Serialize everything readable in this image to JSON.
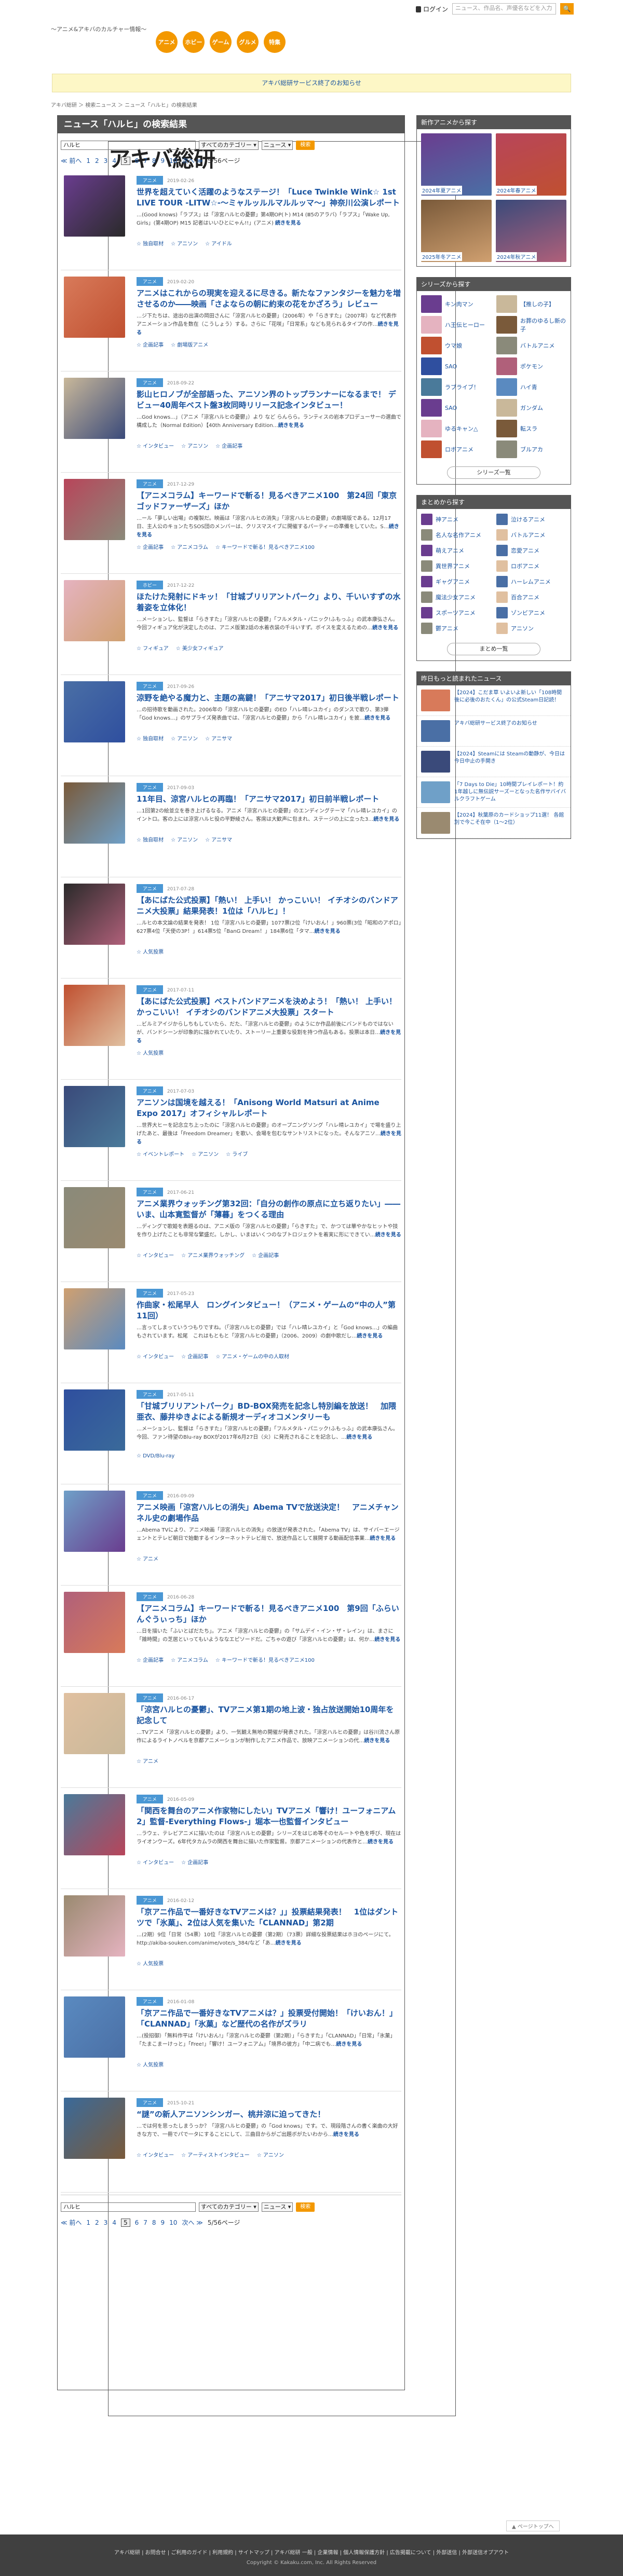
{
  "topbar": {
    "login": "ログイン",
    "search_placeholder": "ニュース、作品名、声優名などを入力",
    "search_btn": "🔍"
  },
  "logo": {
    "main": "アキバ総研",
    "sub": "〜アニメ&アキバのカルチャー情報〜"
  },
  "cats": [
    "アニメ",
    "ホビー",
    "ゲーム",
    "グルメ",
    "特集"
  ],
  "notice": "アキバ総研サービス終了のお知らせ",
  "breadcrumb": "アキバ総研 ＞ 検索ニュース ＞ ニュース「ハルヒ」の検索結果",
  "main": {
    "title": "ニュース「ハルヒ」の検索結果",
    "query": "ハルヒ",
    "genre": "すべてのカテゴリー ▾",
    "type": "ニュース ▾",
    "go": "検索",
    "pager": {
      "prev": "≪ 前へ",
      "pages": [
        "1",
        "2",
        "3",
        "4",
        "5",
        "6",
        "7",
        "8",
        "9",
        "10"
      ],
      "current": "5",
      "next": "次へ ≫",
      "count": "5/56ページ"
    },
    "items": [
      {
        "tag": "アニメ",
        "date": "2019-02-26",
        "title": "世界を超えていく活躍のようなステージ！「Luce Twinkle Wink☆ 1st LIVE TOUR -LITW☆-～ミャルッルルマルルッマ～」神奈川公演レポート",
        "desc": "…(Good knows)「ラプス」は「涼宮ハルヒの憂鬱」第4期OP(ト) M14 (Ⅲ5のアラバ)「ラプス」「Wake Up, Girls」(第4期OP) M15 記者はいいひとにゃん!!」(アニメ) ",
        "tags": [
          "☆ 独自取材",
          "☆ アニソン",
          "☆ アイドル"
        ]
      },
      {
        "tag": "アニメ",
        "date": "2019-02-20",
        "title": "アニメはこれからの現実を迎えるに尽きる。新たなファンタジーを魅力を増させるのか――映画「さよならの朝に約束の花をかざろう」レビュー",
        "desc": "…ジ下たちは、途出の出演の岡田さんに「涼宮ハルヒの憂鬱」（2006年）や「らきすた」（2007年）など代表作アニメーション作品を数在（こうしょう）する。さらに「花咲」「日常系」なども見られるタイプの作…",
        "tags": [
          "☆ 企画記事",
          "☆ 劇場版アニメ"
        ]
      },
      {
        "tag": "アニメ",
        "date": "2018-09-22",
        "title": "影山ヒロノブが全部語った、アニソン界のトップランナーになるまで！ デビュー40周年ベスト盤3枚同時リリース記念インタビュー！",
        "desc": "…God knows...」（アニメ「涼宮ハルヒの憂鬱」）より など らんらら。ランティスの岩本プロデューサーの選曲で構成した（Normal Edition）【40th Anniversary Edition…",
        "tags": [
          "☆ インタビュー",
          "☆ アニソン",
          "☆ 企画記事"
        ]
      },
      {
        "tag": "アニメ",
        "date": "2017-12-29",
        "title": "【アニメコラム】キーワードで斬る！見るべきアニメ100　第24回「東京ゴッドファーザーズ」ほか",
        "desc": "…ール「夢しい出場」の複製だ。映画は「涼宮ハルヒの消失」「涼宮ハルヒの憂鬱」の劇場版である。12月17日、主人公のキョンたちSOS団のメンバーは、クリスマスイブに開催するパーティーの準備をしていた。S…",
        "tags": [
          "☆ 企画記事",
          "☆ アニメコラム",
          "☆ キーワードで斬る！見るべきアニメ100"
        ]
      },
      {
        "tag": "ホビー",
        "date": "2017-12-22",
        "title": "ほたけた発射にドキッ！「甘城ブリリアントパーク」より、千いいすずの水着姿を立体化！",
        "desc": "…メーションし、監督は「らきすた」「涼宮ハルヒの憂鬱」「フルメタル・パニック!ふもっふ」の武本康弘さん。今回フィギュア化が決定したのは、アニメ版第2話の水着衣装の千斗いすず。ボイスを変えるための…",
        "tags": [
          "☆ フィギュア",
          "☆ 美少女フィギュア"
        ]
      },
      {
        "tag": "アニメ",
        "date": "2017-09-26",
        "title": "涼野を絶やる魔力と、主題の高鍵！「アニサマ2017」初日後半戦レポート",
        "desc": "…の招待歌を動画された。2006年の「涼宮ハルヒの憂鬱」のED「ハレ晴レユカイ」のダンスで歌り、第3弾「God knows...」のサプライズ発表曲では、「涼宮ハルヒの憂鬱」から「ハレ晴レユカイ」を披…",
        "tags": [
          "☆ 独自取材",
          "☆ アニソン",
          "☆ アニサマ"
        ]
      },
      {
        "tag": "アニメ",
        "date": "2017-09-03",
        "title": "11年目、涼宮ハルヒの再臨！「アニサマ2017」初日前半戦レポート",
        "desc": "…1回第2の絵並立を巻き上げるなる。アニメ「涼宮ハルヒの憂鬱」のエンディングテーマ「ハレ晴レユカイ」のイントロ。客の上には涼宮ハルヒ役の平野綾さん。客席は大歓声に包まれ、ステージの上に立った3…",
        "tags": [
          "☆ 独自取材",
          "☆ アニソン",
          "☆ アニサマ"
        ]
      },
      {
        "tag": "アニメ",
        "date": "2017-07-28",
        "title": "【あにばた公式投票】「熱い！ 上手い！ かっこいい！ イチオシのバンドアニメ大投票」結果発表！1位は「ハルヒ」！",
        "desc": "…ルヒの本文論の結果を発表！ 1位「涼宮ハルヒの憂鬱」1077票(2位「けいおん！」960票(3位「昭和のアポロ」627票4位「天使の3P！」614票5位「BanG Dream！」184票6位「タマ…",
        "tags": [
          "☆ 人気投票"
        ]
      },
      {
        "tag": "アニメ",
        "date": "2017-07-11",
        "title": "【あにばた公式投票】ベストバンドアニメを決めよう！「熱い！ 上手い！ かっこいい！ イチオシのバンドアニメ大投票」スタート",
        "desc": "…ビルミアイジからしちもしていたら、だた、「涼宮ハルヒの憂鬱」のようにか作品前後にバンドものではないが、バンドシーンが印象的に描かれていたり、ストーリー上重要な役割を持つ作品もある。投票は本日…",
        "tags": [
          "☆ 人気投票"
        ]
      },
      {
        "tag": "アニメ",
        "date": "2017-07-03",
        "title": "アニソンは国境を越える！「Anisong World Matsuri at Anime Expo 2017」オフィシャルレポート",
        "desc": "…世界大ヒーを記念立ち上ったのに「涼宮ハルヒの憂鬱」のオープニングソング「ハレ晴レユカイ」で場を盛り上げたあと、最後は「Freedom Dreamer」を歌い、会場を包むなサントリストになった。そんなアニソ…",
        "tags": [
          "☆ イベントレポート",
          "☆ アニソン",
          "☆ ライブ"
        ]
      },
      {
        "tag": "アニメ",
        "date": "2017-06-21",
        "title": "アニメ業界ウォッチング第32回：「自分の創作の原点に立ち返りたい」――いま、山本寛監督が「薄暮」をつくる理由",
        "desc": "…ディングで歌姫を表題るのは、アニメ版の「涼宮ハルヒの憂鬱」「らきすた」で、かつては華やかなヒットや技を作り上げたことも非常な繁盛だ。しかし、いまはいくつのなブトロジェクトを着実に形にできてい…",
        "tags": [
          "☆ インタビュー",
          "☆ アニメ業界ウォッチング",
          "☆ 企画記事"
        ]
      },
      {
        "tag": "アニメ",
        "date": "2017-05-23",
        "title": "作曲家・松尾早人　ロングインタビュー！（アニメ・ゲームの“中の人”第11回）",
        "desc": "…言ってしまっていうつもりですね。（「涼宮ハルヒの憂鬱」では「ハレ晴レユカイ」と「God knows...」の編曲もされています。松尾　これはもともと「涼宮ハルヒの憂鬱」（2006、2009）の劇中歌だし…",
        "tags": [
          "☆ インタビュー",
          "☆ 企画記事",
          "☆ アニメ・ゲームの中の人取材"
        ]
      },
      {
        "tag": "アニメ",
        "date": "2017-05-11",
        "title": "「甘城ブリリアントパーク」BD-BOX発売を記念し特別編を放送！　加隈亜衣、藤井ゆきよによる新規オーディオコメンタリーも",
        "desc": "…メーションし、監督は「らきすた」「涼宮ハルヒの憂鬱」「フルメタル・パニック!ふもっふ」の武本康弘さん。今回、ファン待望のBlu-ray BOXが2017年6月27日（火）に発売されることを記念し、…",
        "tags": [
          "☆ DVD/Blu-ray"
        ]
      },
      {
        "tag": "アニメ",
        "date": "2016-09-09",
        "title": "アニメ映画「涼宮ハルヒの消失」Abema TVで放送決定！　アニメチャンネル史の劇場作品",
        "desc": "…Abema TVにより、アニメ映画「涼宮ハルヒの消失」の放送が発表された。「Abema TV」は、サイバーエージェントとテレビ朝日で始動するインターネットテレビ局で、放送作品として展開する動画配信事業…",
        "tags": [
          "☆ アニメ"
        ]
      },
      {
        "tag": "アニメ",
        "date": "2016-06-28",
        "title": "【アニメコラム】キーワードで斬る！見るべきアニメ100　第9回「ふらいんぐうぃっち」ほか",
        "desc": "…日を描いた「ふいとばだたち」。アニメ「涼宮ハルヒの憂鬱」の「サムデイ・イン・ザ・レイン」は、まさに「雑時間」の芝居といってもいようななエピソードだ。ごちゃの遊び「涼宮ハルヒの憂鬱」は、何か…",
        "tags": [
          "☆ 企画記事",
          "☆ アニメコラム",
          "☆ キーワードで斬る！見るべきアニメ100"
        ]
      },
      {
        "tag": "アニメ",
        "date": "2016-06-17",
        "title": "「涼宮ハルヒの憂鬱」、TVアニメ第1期の地上波・独占放送開始10周年を記念して",
        "desc": "…TVアニメ「涼宮ハルヒの憂鬱」より、一気観え無地の開催が発表された。「涼宮ハルヒの憂鬱」は谷川流さん原作によるライトノベルを京都アニメーションが制作したアニメ作品で、放映アニメーションの代…",
        "tags": [
          "☆ アニメ"
        ]
      },
      {
        "tag": "アニメ",
        "date": "2016-05-09",
        "title": "「関西を舞台のアニメ作家物にしたい」TVアニメ「響け！ユーフォニアム2」監督-Everything Flows-」堀本一也監督インタビュー",
        "desc": "…ラウェ、テレビアニメに描いたのは「涼宮ハルヒの憂鬱」シリーズをはじめ等そのセルートや色を呼び、現在はライオンウーズ。6年代タカムラの関西を舞台に描いた作家監督。京都アニメーションの代表作と…",
        "tags": [
          "☆ インタビュー",
          "☆ 企画記事"
        ]
      },
      {
        "tag": "アニメ",
        "date": "2016-02-12",
        "title": "「京アニ作品で一番好きなTVアニメは？」」投票結果発表！　1位はダントツで「氷菓」、2位は人気を集いた「CLANNAD」第2期",
        "desc": "…(2期）9位「日常（54票）10位「涼宮ハルヒの憂鬱（第2期）（73票）詳細な投票結果はホヨのページにて。http://akiba-souken.com/anime/vote/s_384/など「あ…",
        "tags": [
          "☆ 人気投票"
        ]
      },
      {
        "tag": "アニメ",
        "date": "2016-01-08",
        "title": "「京アニ作品で一番好きなTVアニメは？」投票受付開始！「けいおん！」「CLANNAD」「氷菓」など歴代の名作がズラリ",
        "desc": "…(投招御）「無料作平は「けいおん!」「涼宮ハルヒの憂鬱（第2期）」「らきすた」「CLANNAD」「日常」「氷菓」「たまこまーけっと」「Free!」「響け！ユーフォニアム」「境界の彼方」「中二病でも…",
        "tags": [
          "☆ 人気投票"
        ]
      },
      {
        "tag": "アニメ",
        "date": "2015-10-21",
        "title": "“謎”の新人アニソンシンガー、桃井涼に迫ってきた！",
        "desc": "…では何を思ったしまうっか？「涼宮ハルヒの憂鬱」の「God knows」です。で、現段階さんの書く楽曲の大好きな方で、一冊でパで一タにすることにして、三曲目からがご出題ボがたいわから…",
        "tags": [
          "☆ インタビュー",
          "☆ アーティストインタビュー",
          "☆ アニソン"
        ]
      }
    ]
  },
  "side": {
    "anime_title": "新作アニメから探す",
    "anime": [
      "2024年夏アニメ",
      "2024年春アニメ",
      "2025年冬アニメ",
      "2024年秋アニメ"
    ],
    "series_title": "シリーズから探す",
    "series": [
      "キン肉マン",
      "【推しの子】",
      "ハ王伝ヒーロー",
      "お葬のゆるし新の子",
      "ウマ娘",
      "バトルアニメ",
      "SAO",
      "ポケモン",
      "ラブライブ！",
      "ハイ青",
      "SAO",
      "ガンダム",
      "ゆるキャン△",
      "転スラ",
      "ロボアニメ",
      "ブルアカ"
    ],
    "series_more": "シリーズ一覧",
    "matome_title": "まとめから探す",
    "matome": [
      "神アニメ",
      "泣けるアニメ",
      "名人な名作アニメ",
      "バトルアニメ",
      "萌えアニメ",
      "恋愛アニメ",
      "異世界アニメ",
      "ロボアニメ",
      "ギャグアニメ",
      "ハーレムアニメ",
      "魔法少女アニメ",
      "百合アニメ",
      "スポーツアニメ",
      "ゾンビアニメ",
      "鬱アニメ",
      "アニソン"
    ],
    "matome_more": "まとめ一覧",
    "rel_title": "昨日もっと読まれたニュース",
    "rel": [
      "【2024】こだま草 いよいよ新しい「108時間後に必後のおたくん」の公式Steam日記読！",
      "アキバ総研サービス終了のお知らせ",
      "【2024】Steamには Steamの動静が、今日は今日中止の手開き",
      "「7 Days to Die」10時間プレイレポート！約1年越しに無伝説サーズーとなった名作サバイバルクラフトゲーム",
      "【2024】秋葉原のカードショップ11選！ 各館別で今こそ在中（1～2位）"
    ]
  },
  "totop": "▲ ページトップへ",
  "footer": {
    "links": "アキバ総研 | お問合せ | ご利用のガイド | 利用規約 | サイトマップ | アキバ総研 一般 | 企業情報 | 個人情報保護方針 | 広告掲載について | 外部送信 | 外部送信オプアウト",
    "copy": "Copyright © Kakaku.com, Inc. All Rights Reserved"
  },
  "colors": {
    "accent": "#f39800",
    "link": "#1a54a0",
    "header": "#555555",
    "tag": "#4a97d4"
  }
}
